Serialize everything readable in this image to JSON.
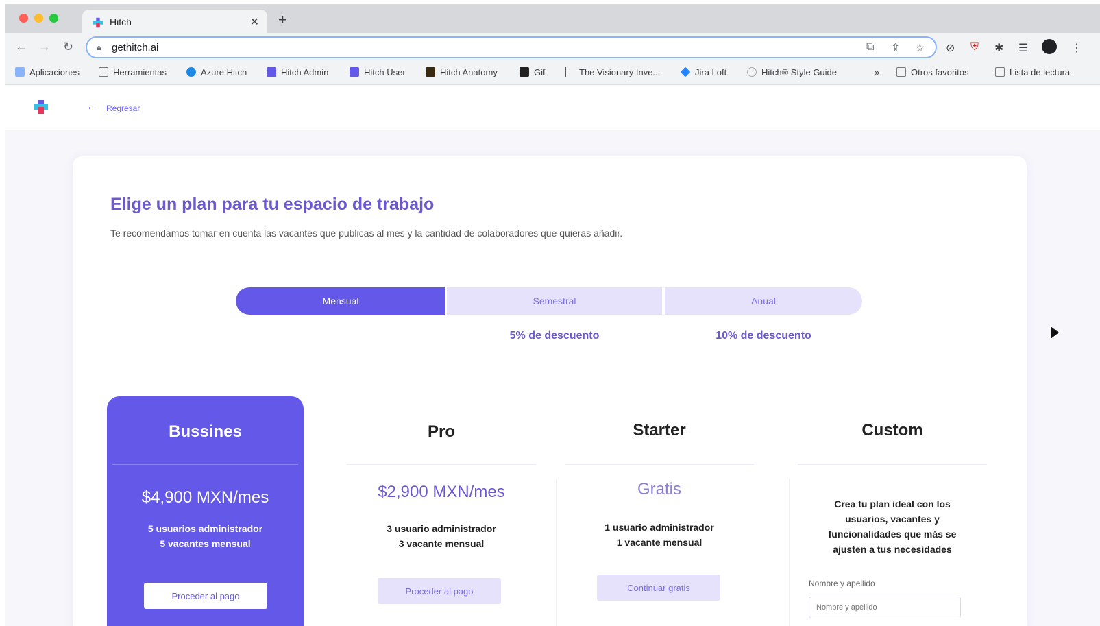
{
  "browser": {
    "tab_title": "Hitch",
    "url": "gethitch.ai",
    "bookmarks": [
      "Aplicaciones",
      "Herramientas",
      "Azure Hitch",
      "Hitch Admin",
      "Hitch User",
      "Hitch Anatomy",
      "Gif",
      "The Visionary Inve...",
      "Jira Loft",
      "Hitch® Style Guide",
      "»",
      "Otros favoritos",
      "Lista de lectura"
    ]
  },
  "nav": {
    "back_label": "Regresar"
  },
  "page": {
    "title": "Elige un plan para tu espacio de trabajo",
    "subtitle": "Te recomendamos tomar en cuenta las vacantes que publicas al mes y la cantidad de colaboradores que quieras añadir."
  },
  "billing": {
    "options": [
      "Mensual",
      "Semestral",
      "Anual"
    ],
    "selected": "Mensual",
    "discounts": [
      "5% de descuento",
      "10% de descuento"
    ]
  },
  "plans": [
    {
      "name": "Bussines",
      "price": "$4,900 MXN/mes",
      "features": [
        "5 usuarios administrador",
        "5 vacantes mensual"
      ],
      "button": "Proceder al pago"
    },
    {
      "name": "Pro",
      "price": "$2,900 MXN/mes",
      "features": [
        "3 usuario administrador",
        "3 vacante mensual"
      ],
      "button": "Proceder al pago"
    },
    {
      "name": "Starter",
      "price": "Gratis",
      "features": [
        "1 usuario administrador",
        "1 vacante mensual"
      ],
      "button": "Continuar gratis"
    },
    {
      "name": "Custom",
      "description": "Crea tu plan ideal con los usuarios, vacantes y funcionalidades que más se ajusten a tus necesidades",
      "field_label": "Nombre y apellido",
      "field_placeholder": "Nombre y apellido"
    }
  ],
  "colors": {
    "accent": "#6458e8",
    "accent_light": "#e6e2fb",
    "heading": "#6a5acd"
  }
}
